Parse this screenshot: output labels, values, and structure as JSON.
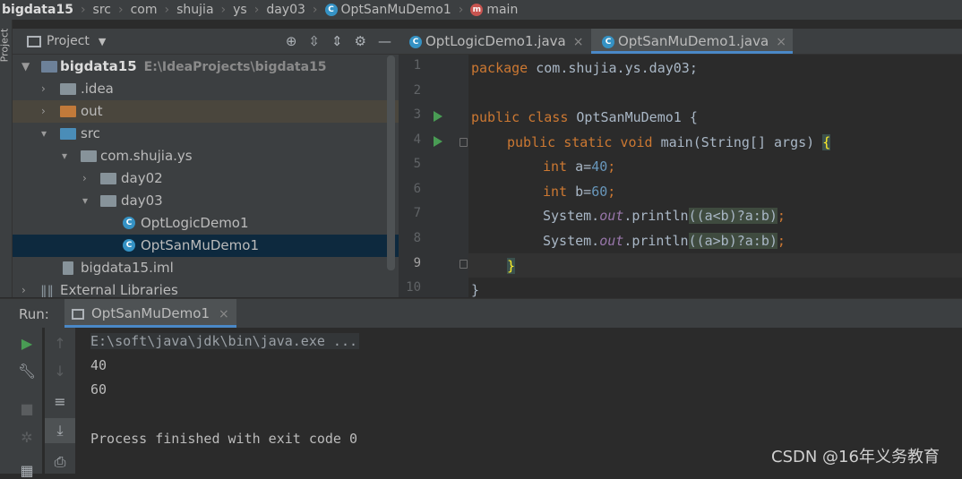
{
  "breadcrumb": {
    "items": [
      "bigdata15",
      "src",
      "com",
      "shujia",
      "ys",
      "day03",
      "OptSanMuDemo1",
      "main"
    ]
  },
  "left_stripe": {
    "label": "Project"
  },
  "project_panel": {
    "title": "Project",
    "tree": [
      {
        "label": "bigdata15",
        "hint": "E:\\IdeaProjects\\bigdata15"
      },
      {
        "label": ".idea"
      },
      {
        "label": "out"
      },
      {
        "label": "src"
      },
      {
        "label": "com.shujia.ys"
      },
      {
        "label": "day02"
      },
      {
        "label": "day03"
      },
      {
        "label": "OptLogicDemo1"
      },
      {
        "label": "OptSanMuDemo1"
      },
      {
        "label": "bigdata15.iml"
      },
      {
        "label": "External Libraries"
      }
    ]
  },
  "editor": {
    "tabs": [
      {
        "label": "OptLogicDemo1.java",
        "active": false
      },
      {
        "label": "OptSanMuDemo1.java",
        "active": true
      }
    ],
    "line_numbers": [
      "1",
      "2",
      "3",
      "4",
      "5",
      "6",
      "7",
      "8",
      "9",
      "10"
    ],
    "code": {
      "l1_kw": "package",
      "l1_rest": " com.shujia.ys.day03;",
      "l3_kw": "public class",
      "l3_rest": " OptSanMuDemo1 {",
      "l4_kw": "public static void",
      "l4_name": " main(String[] args) ",
      "l4_brace": "{",
      "l5_kw": "int",
      "l5_var": " a=",
      "l5_num": "40",
      "l5_end": ";",
      "l6_kw": "int",
      "l6_var": " b=",
      "l6_num": "60",
      "l6_end": ";",
      "l7_pre": "System.",
      "l7_out": "out",
      "l7_mid": ".println",
      "l7_grp": "((a<b)?a:b)",
      "l7_end": ";",
      "l8_pre": "System.",
      "l8_out": "out",
      "l8_mid": ".println",
      "l8_grp": "((a>b)?a:b)",
      "l8_end": ";",
      "l9": "}",
      "l10": "}"
    }
  },
  "run_panel": {
    "label": "Run:",
    "tab": "OptSanMuDemo1",
    "console": [
      "E:\\soft\\java\\jdk\\bin\\java.exe ...",
      "40",
      "60",
      "",
      "Process finished with exit code 0"
    ]
  },
  "watermark": "CSDN @16年义务教育",
  "colors": {
    "keyword": "#cc7832",
    "number": "#6897bb",
    "static_field": "#9876aa",
    "run_green": "#499c54",
    "accent_blue": "#4a88c7"
  }
}
